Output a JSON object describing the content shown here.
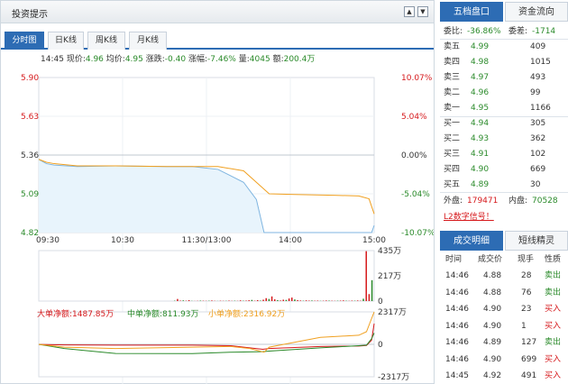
{
  "header": {
    "title": "投资提示",
    "scroll_up": "▲",
    "scroll_down": "▼"
  },
  "chart_tabs": [
    "分时图",
    "日K线",
    "周K线",
    "月K线"
  ],
  "info": {
    "time": "14:45",
    "price_label": "现价:",
    "price": "4.96",
    "avg_label": "均价:",
    "avg": "4.95",
    "change_label": "涨跌:",
    "change": "-0.40",
    "pct_label": "涨幅:",
    "pct": "-7.46%",
    "vol_label": "量:",
    "vol": "4045",
    "amt_label": "额:",
    "amt": "200.4万"
  },
  "flow_legend": {
    "big": "大单净额:1487.85万",
    "mid": "中单净额:811.93万",
    "small": "小单净额:2316.92万"
  },
  "chart_data": [
    {
      "type": "line",
      "x_ticks": [
        "09:30",
        "10:30",
        "11:30/13:00",
        "14:00",
        "15:00"
      ],
      "y_ticks_left": [
        "5.90",
        "5.63",
        "5.36",
        "5.09",
        "4.82"
      ],
      "y_ticks_right": [
        "10.07%",
        "5.04%",
        "0.00%",
        "-5.04%",
        "-10.07%"
      ],
      "ylim": [
        4.82,
        5.9
      ],
      "prev_close": 5.36,
      "series": [
        {
          "name": "价格",
          "x": [
            0,
            6,
            12,
            30,
            60,
            100,
            120,
            140,
            160,
            170,
            176,
            190,
            240,
            250,
            260,
            262
          ],
          "y": [
            5.33,
            5.3,
            5.29,
            5.28,
            5.285,
            5.28,
            5.28,
            5.26,
            5.17,
            5.05,
            4.82,
            4.82,
            4.82,
            4.82,
            4.82,
            4.87
          ]
        },
        {
          "name": "均价",
          "x": [
            0,
            6,
            12,
            30,
            60,
            100,
            120,
            140,
            160,
            170,
            180,
            200,
            230,
            250,
            258,
            262
          ],
          "y": [
            5.33,
            5.31,
            5.3,
            5.285,
            5.285,
            5.28,
            5.28,
            5.28,
            5.25,
            5.17,
            5.09,
            5.085,
            5.08,
            5.075,
            5.055,
            4.95
          ]
        }
      ]
    },
    {
      "type": "bar",
      "y_ticks": [
        "435万",
        "217万",
        "0"
      ],
      "ylim": [
        0,
        435
      ],
      "values": [
        3,
        18,
        4,
        6,
        3,
        8,
        2,
        1,
        2,
        4,
        3,
        2,
        3,
        5,
        2,
        1,
        3,
        2,
        2,
        4,
        2,
        3,
        2,
        6,
        3,
        4,
        7,
        10,
        3,
        8,
        4,
        12,
        25,
        18,
        40,
        15,
        8,
        5,
        12,
        10,
        22,
        30,
        14,
        8,
        5,
        3,
        6,
        4,
        5,
        3,
        4,
        2,
        3,
        5,
        4,
        3,
        2,
        3,
        4,
        6,
        3,
        2,
        4,
        3,
        5,
        3,
        20,
        430,
        60,
        180
      ]
    },
    {
      "type": "line",
      "y_ticks": [
        "2317万",
        "0",
        "-2317万"
      ],
      "ylim": [
        -2317,
        2317
      ],
      "series": [
        {
          "name": "大单净额",
          "x": [
            0,
            20,
            60,
            120,
            150,
            175,
            180,
            220,
            250,
            256,
            260,
            262
          ],
          "y": [
            -10,
            -40,
            -60,
            -60,
            -100,
            -350,
            -300,
            -150,
            -120,
            -80,
            300,
            1487
          ]
        },
        {
          "name": "中单净额",
          "x": [
            0,
            20,
            60,
            120,
            150,
            175,
            180,
            220,
            250,
            256,
            260,
            262
          ],
          "y": [
            0,
            -300,
            -650,
            -660,
            -560,
            -520,
            -480,
            -250,
            -100,
            -60,
            400,
            812
          ]
        },
        {
          "name": "小单净额",
          "x": [
            0,
            20,
            60,
            120,
            150,
            165,
            176,
            180,
            220,
            250,
            256,
            262
          ],
          "y": [
            0,
            -200,
            -300,
            -200,
            -150,
            -300,
            -560,
            -200,
            500,
            650,
            900,
            2317
          ]
        }
      ]
    }
  ],
  "order_book": {
    "tabs": [
      "五档盘口",
      "资金流向"
    ],
    "ratio_label": "委比:",
    "ratio": "-36.86%",
    "diff_label": "委差:",
    "diff": "-1714",
    "asks": [
      {
        "label": "卖五",
        "price": "4.99",
        "qty": "409"
      },
      {
        "label": "卖四",
        "price": "4.98",
        "qty": "1015"
      },
      {
        "label": "卖三",
        "price": "4.97",
        "qty": "493"
      },
      {
        "label": "卖二",
        "price": "4.96",
        "qty": "99"
      },
      {
        "label": "卖一",
        "price": "4.95",
        "qty": "1166"
      }
    ],
    "bids": [
      {
        "label": "买一",
        "price": "4.94",
        "qty": "305"
      },
      {
        "label": "买二",
        "price": "4.93",
        "qty": "362"
      },
      {
        "label": "买三",
        "price": "4.91",
        "qty": "102"
      },
      {
        "label": "买四",
        "price": "4.90",
        "qty": "669"
      },
      {
        "label": "买五",
        "price": "4.89",
        "qty": "30"
      }
    ],
    "outer_label": "外盘:",
    "outer": "179471",
    "inner_label": "内盘:",
    "inner": "70528",
    "l2_link": "L2数字信号！"
  },
  "trades": {
    "tabs": [
      "成交明细",
      "短线精灵"
    ],
    "headers": [
      "时间",
      "成交价",
      "现手",
      "性质"
    ],
    "rows": [
      {
        "time": "14:46",
        "price": "4.88",
        "qty": "28",
        "type": "卖出"
      },
      {
        "time": "14:46",
        "price": "4.88",
        "qty": "76",
        "type": "卖出"
      },
      {
        "time": "14:46",
        "price": "4.90",
        "qty": "23",
        "type": "买入"
      },
      {
        "time": "14:46",
        "price": "4.90",
        "qty": "1",
        "type": "买入"
      },
      {
        "time": "14:46",
        "price": "4.89",
        "qty": "127",
        "type": "卖出"
      },
      {
        "time": "14:46",
        "price": "4.90",
        "qty": "699",
        "type": "买入"
      },
      {
        "time": "14:45",
        "price": "4.92",
        "qty": "491",
        "type": "买入"
      }
    ]
  },
  "colors": {
    "up": "#d6191c",
    "down": "#2a8a2a",
    "accent": "#2d6cb4",
    "price_line": "#7fb5e0",
    "avg_line": "#f0a020"
  }
}
